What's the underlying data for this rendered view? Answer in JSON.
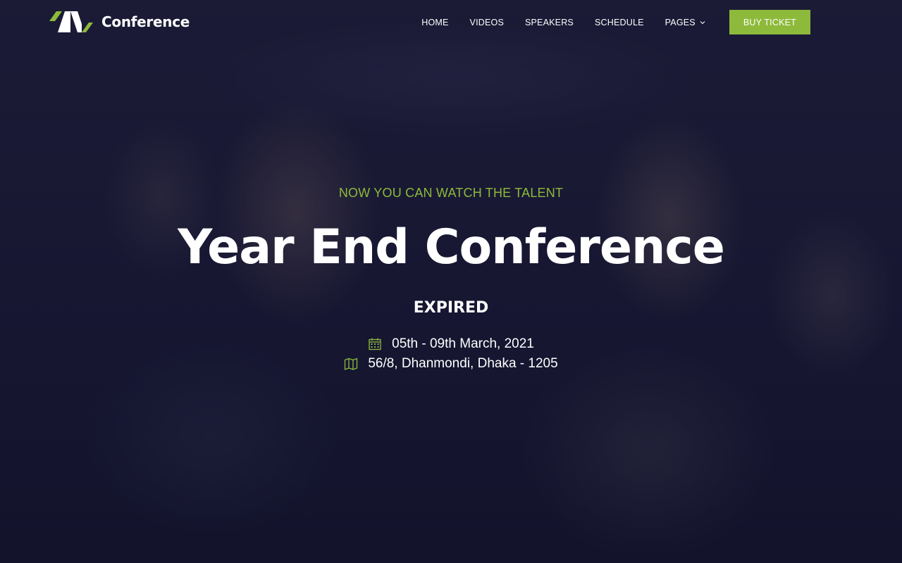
{
  "brand": {
    "name": "Conference",
    "accent_color": "#8dba3a"
  },
  "nav": {
    "items": [
      {
        "label": "HOME"
      },
      {
        "label": "VIDEOS"
      },
      {
        "label": "SPEAKERS"
      },
      {
        "label": "SCHEDULE"
      },
      {
        "label": "PAGES",
        "has_dropdown": true
      }
    ],
    "cta_label": "BUY TICKET"
  },
  "hero": {
    "kicker": "NOW YOU CAN WATCH THE TALENT",
    "title": "Year End Conference",
    "status": "EXPIRED",
    "date": "05th - 09th March, 2021",
    "date_icon": "calendar-icon",
    "location": "56/8, Dhanmondi, Dhaka - 1205",
    "location_icon": "map-icon"
  }
}
